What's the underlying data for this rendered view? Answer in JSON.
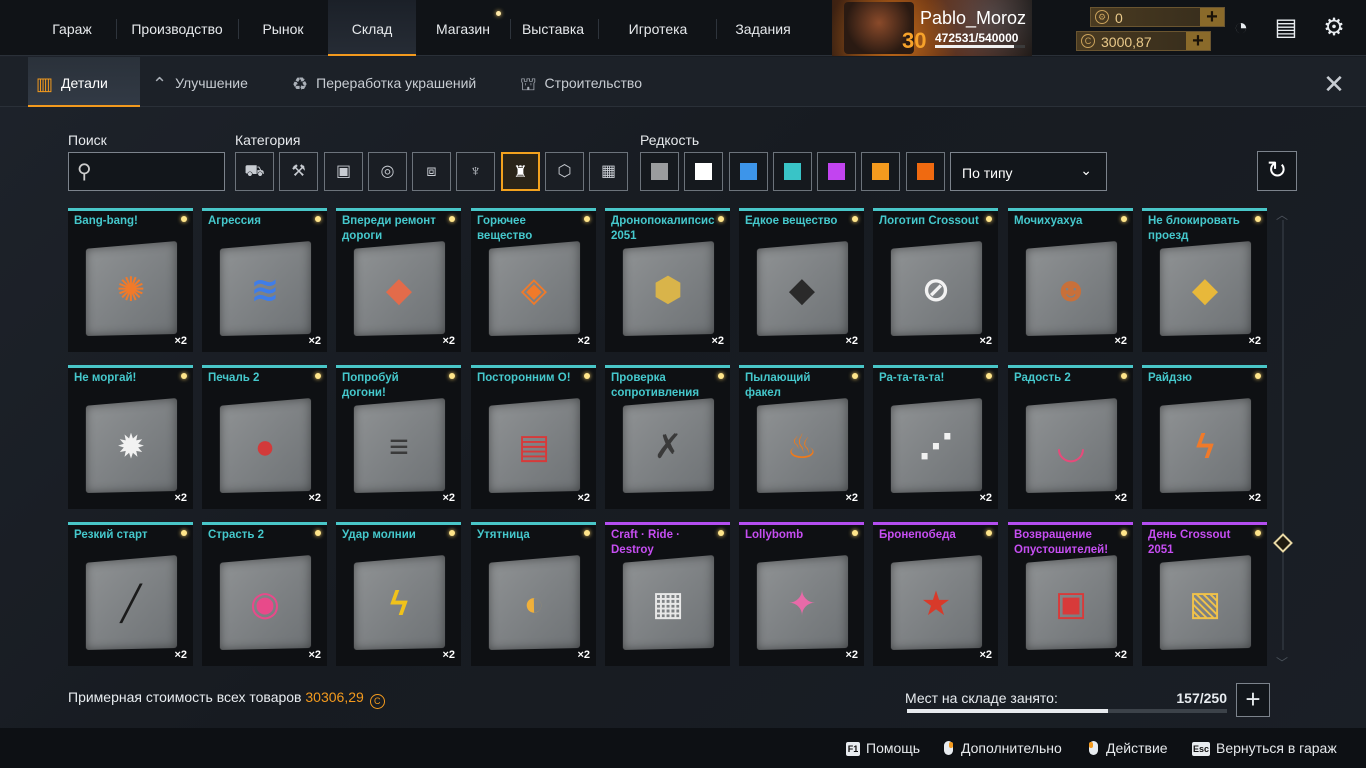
{
  "nav": {
    "items": [
      "Гараж",
      "Производство",
      "Рынок",
      "Склад",
      "Магазин",
      "Выставка",
      "Игротека",
      "Задания"
    ],
    "active": "Склад"
  },
  "player": {
    "name": "Pablo_Moroz",
    "level": "30",
    "xp": "472531/540000",
    "xp_fraction": 0.875
  },
  "currency": {
    "coins": "0",
    "credits": "3000,87"
  },
  "subtabs": [
    "Детали",
    "Улучшение",
    "Переработка украшений",
    "Строительство"
  ],
  "filters": {
    "search_label": "Поиск",
    "search_value": "",
    "category_label": "Категория",
    "rarity_label": "Редкость",
    "sort_value": "По типу"
  },
  "category_icons": [
    "cabin-icon",
    "weapon-icon",
    "module-icon",
    "wheel-icon",
    "frame-icon",
    "decor-icon",
    "paint-icon",
    "hexagon-icon",
    "grid-icon"
  ],
  "rarity_colors": [
    "#9a9c9e",
    "#ffffff",
    "#3d95ea",
    "#39c4c7",
    "#c244f0",
    "#f39a1e",
    "#f06a10"
  ],
  "items": [
    {
      "name": "Bang-bang!",
      "qty": "×2",
      "rarity": "rare",
      "color": "#f07a2a",
      "glyph": "✺"
    },
    {
      "name": "Агрессия",
      "qty": "×2",
      "rarity": "rare",
      "color": "#3f7de8",
      "glyph": "≋"
    },
    {
      "name": "Впереди ремонт дороги",
      "qty": "×2",
      "rarity": "rare",
      "color": "#e36b4a",
      "glyph": "◆"
    },
    {
      "name": "Горючее вещество",
      "qty": "×2",
      "rarity": "rare",
      "color": "#f07a2a",
      "glyph": "◈"
    },
    {
      "name": "Дронопокалипсис 2051",
      "qty": "×2",
      "rarity": "rare",
      "color": "#d9b44a",
      "glyph": "⬢"
    },
    {
      "name": "Едкое вещество",
      "qty": "×2",
      "rarity": "rare",
      "color": "#2a2a2a",
      "glyph": "◆"
    },
    {
      "name": "Логотип Crossout",
      "qty": "×2",
      "rarity": "rare",
      "color": "#f2f2f2",
      "glyph": "⊘"
    },
    {
      "name": "Мочихуахуа",
      "qty": "×2",
      "rarity": "rare",
      "color": "#c8703a",
      "glyph": "☻"
    },
    {
      "name": "Не блокировать проезд",
      "qty": "×2",
      "rarity": "rare",
      "color": "#e8b83a",
      "glyph": "◆"
    },
    {
      "name": "Не моргай!",
      "qty": "×2",
      "rarity": "rare",
      "color": "#f2f2f2",
      "glyph": "✹"
    },
    {
      "name": "Печаль 2",
      "qty": "×2",
      "rarity": "rare",
      "color": "#d33a3a",
      "glyph": "●"
    },
    {
      "name": "Попробуй догони!",
      "qty": "×2",
      "rarity": "rare",
      "color": "#3a3a3a",
      "glyph": "≡"
    },
    {
      "name": "Посторонним О!",
      "qty": "×2",
      "rarity": "rare",
      "color": "#d63a3a",
      "glyph": "▤"
    },
    {
      "name": "Проверка сопротивления",
      "qty": "",
      "rarity": "rare",
      "color": "#3a3a3a",
      "glyph": "✗"
    },
    {
      "name": "Пылающий факел",
      "qty": "×2",
      "rarity": "rare",
      "color": "#f07a1a",
      "glyph": "♨"
    },
    {
      "name": "Ра-та-та-та!",
      "qty": "×2",
      "rarity": "rare",
      "color": "#f2f2f2",
      "glyph": "⋰"
    },
    {
      "name": "Радость 2",
      "qty": "×2",
      "rarity": "rare",
      "color": "#e84a7a",
      "glyph": "◡"
    },
    {
      "name": "Райдзю",
      "qty": "×2",
      "rarity": "rare",
      "color": "#f07a2a",
      "glyph": "ϟ"
    },
    {
      "name": "Резкий старт",
      "qty": "×2",
      "rarity": "rare",
      "color": "#1a1a1a",
      "glyph": "╱"
    },
    {
      "name": "Страсть 2",
      "qty": "×2",
      "rarity": "rare",
      "color": "#e84a8a",
      "glyph": "◉"
    },
    {
      "name": "Удар молнии",
      "qty": "×2",
      "rarity": "rare",
      "color": "#f0c21a",
      "glyph": "ϟ"
    },
    {
      "name": "Утятница",
      "qty": "×2",
      "rarity": "rare",
      "color": "#f0b03a",
      "glyph": "◐"
    },
    {
      "name": "Craft · Ride · Destroy",
      "qty": "",
      "rarity": "epic",
      "color": "#e8e8e8",
      "glyph": "▦"
    },
    {
      "name": "Lollybomb",
      "qty": "×2",
      "rarity": "epic",
      "color": "#e86aa8",
      "glyph": "✦"
    },
    {
      "name": "Бронепобеда",
      "qty": "×2",
      "rarity": "epic",
      "color": "#d83a2a",
      "glyph": "★"
    },
    {
      "name": "Возвращение Опустошителей!",
      "qty": "×2",
      "rarity": "epic",
      "color": "#d83a3a",
      "glyph": "▣"
    },
    {
      "name": "День Crossout 2051",
      "qty": "",
      "rarity": "epic",
      "color": "#f0c24a",
      "glyph": "▧"
    }
  ],
  "footer": {
    "value_label": "Примерная стоимость всех товаров",
    "value": "30306,29",
    "capacity_label": "Мест на складе занято:",
    "capacity": "157/250",
    "capacity_fraction": 0.628
  },
  "hints": [
    {
      "key": "F1",
      "label": "Помощь"
    },
    {
      "key": "mouse-r",
      "label": "Дополнительно"
    },
    {
      "key": "mouse-l",
      "label": "Действие"
    },
    {
      "key": "Esc",
      "label": "Вернуться в гараж"
    }
  ]
}
